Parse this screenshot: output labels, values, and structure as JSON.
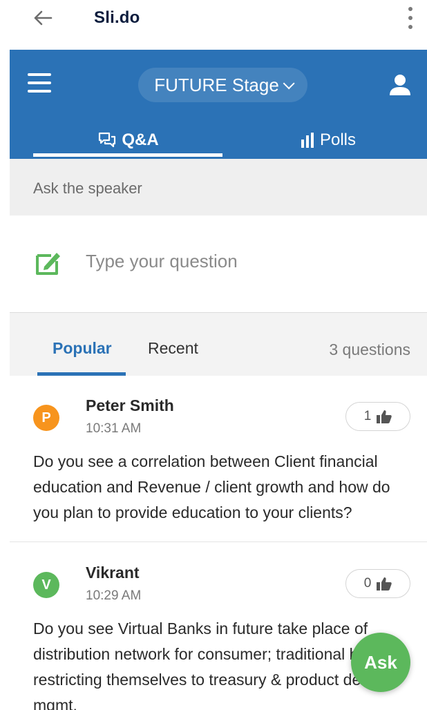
{
  "app": {
    "title": "Sli.do"
  },
  "header": {
    "event_name": "FUTURE Stage",
    "tabs": [
      {
        "label": "Q&A",
        "active": true,
        "icon": "chat-bubbles-icon"
      },
      {
        "label": "Polls",
        "active": false,
        "icon": "bar-chart-icon"
      }
    ]
  },
  "ask": {
    "label": "Ask the speaker",
    "input_placeholder": "Type your question",
    "fab_label": "Ask"
  },
  "filters": {
    "tabs": [
      {
        "label": "Popular",
        "active": true
      },
      {
        "label": "Recent",
        "active": false
      }
    ],
    "count_label": "3 questions"
  },
  "questions": [
    {
      "initial": "P",
      "author": "Peter Smith",
      "time": "10:31 AM",
      "likes": "1",
      "avatar_color": "#f7941d",
      "text": "Do you see a correlation between Client financial education and Revenue / client growth and how do you plan to provide education to your clients?"
    },
    {
      "initial": "V",
      "author": "Vikrant",
      "time": "10:29 AM",
      "likes": "0",
      "avatar_color": "#5cb85c",
      "text": "Do you see Virtual Banks in future take place of distribution network for consumer; traditional banks restricting themselves to treasury & product dev. & mgmt."
    }
  ],
  "colors": {
    "brand_blue": "#2b72b6",
    "accent_green": "#5cb85c",
    "avatar_orange": "#f7941d"
  }
}
